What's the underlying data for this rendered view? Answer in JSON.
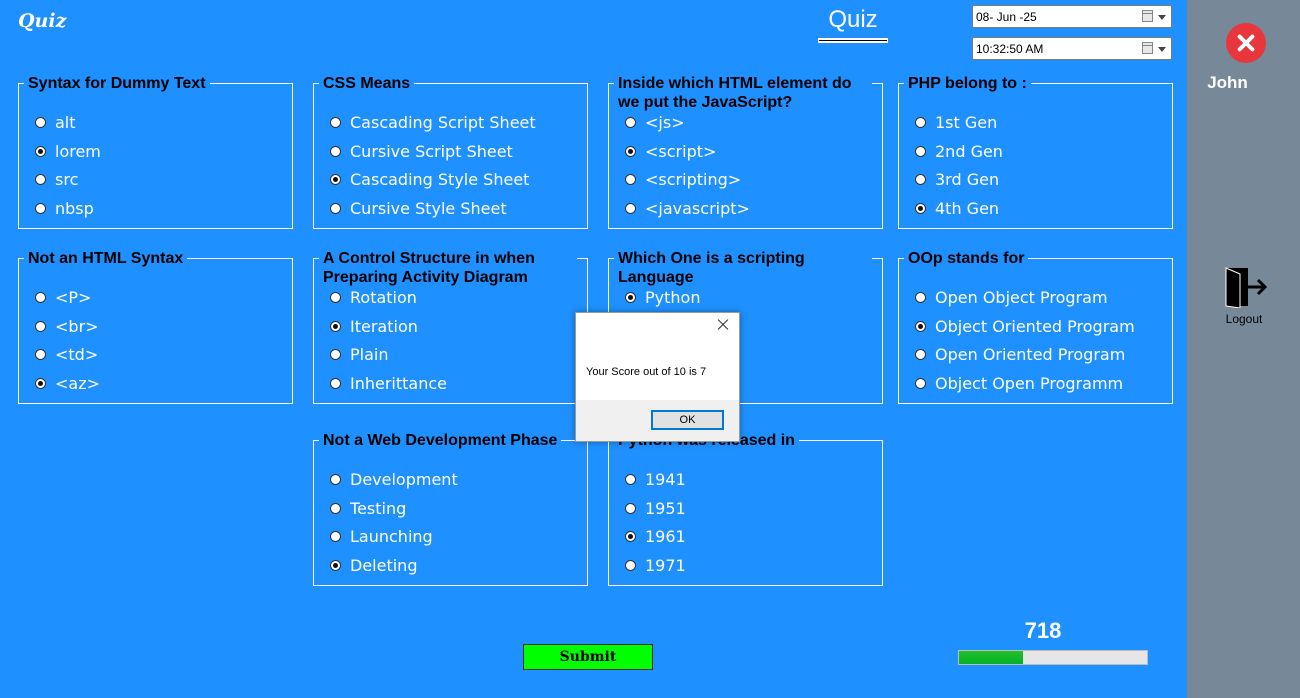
{
  "app": {
    "logo": "Quiz",
    "title": "Quiz"
  },
  "datetime": {
    "date": "08- Jun -25",
    "time": "10:32:50 AM"
  },
  "questions": [
    {
      "title": "Syntax for Dummy Text",
      "options": [
        "alt",
        "lorem",
        "src",
        "nbsp"
      ],
      "selected": 1
    },
    {
      "title": "CSS Means",
      "options": [
        "Cascading Script Sheet",
        "Cursive Script Sheet",
        "Cascading Style Sheet",
        "Cursive Style Sheet"
      ],
      "selected": 2
    },
    {
      "title": "Inside which HTML element do we put the JavaScript?",
      "options": [
        "<js>",
        "<script>",
        "<scripting>",
        "<javascript>"
      ],
      "selected": 1
    },
    {
      "title": "PHP belong to :",
      "options": [
        "1st Gen",
        "2nd Gen",
        "3rd Gen",
        "4th Gen"
      ],
      "selected": 3
    },
    {
      "title": "Not an HTML Syntax",
      "options": [
        "<P>",
        "<br>",
        "<td>",
        "<az>"
      ],
      "selected": 3
    },
    {
      "title": "A Control Structure in when Preparing Activity Diagram",
      "options": [
        "Rotation",
        "Iteration",
        "Plain",
        "Inherittance"
      ],
      "selected": 1
    },
    {
      "title": "Which One is a scripting Language",
      "options": [
        "Python"
      ],
      "selected": 0
    },
    {
      "title": "OOp stands for",
      "options": [
        "Open Object Program",
        "Object Oriented Program",
        "Open Oriented Program",
        "Object Open Programm"
      ],
      "selected": 1
    },
    {
      "title": "Not a Web Development Phase",
      "options": [
        "Development",
        "Testing",
        "Launching",
        "Deleting"
      ],
      "selected": 3
    },
    {
      "title": "Python was released in",
      "options": [
        "1941",
        "1951",
        "1961",
        "1971"
      ],
      "selected": 2
    }
  ],
  "submit_label": "Submit",
  "timer": {
    "value": "718",
    "progress_percent": 34
  },
  "sidebar": {
    "user": "John",
    "logout_label": "Logout"
  },
  "dialog": {
    "message": "Your Score out of 10 is 7",
    "ok_label": "OK"
  }
}
